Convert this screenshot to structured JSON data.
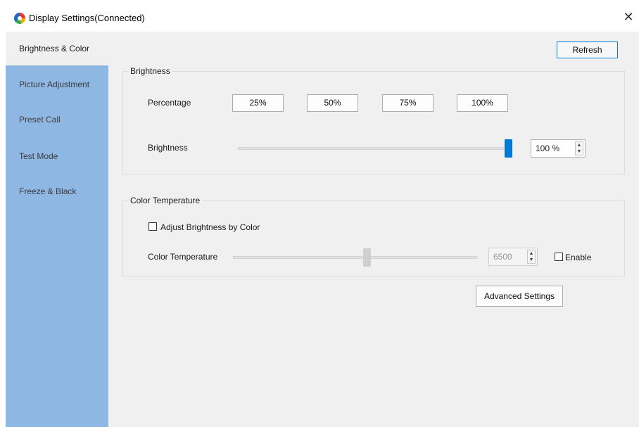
{
  "window": {
    "title": "Display Settings(Connected)",
    "close_icon": "close-icon",
    "close_glyph": "✕",
    "app_icon": "app-logo-icon"
  },
  "sidebar": {
    "items": [
      {
        "label": "Brightness & Color",
        "active": true
      },
      {
        "label": "Picture Adjustment",
        "active": false
      },
      {
        "label": "Preset Call",
        "active": false
      },
      {
        "label": "Test Mode",
        "active": false
      },
      {
        "label": "Freeze & Black",
        "active": false
      }
    ]
  },
  "toolbar": {
    "refresh_label": "Refresh"
  },
  "brightness_group": {
    "title": "Brightness",
    "percentage_label": "Percentage",
    "presets": [
      "25%",
      "50%",
      "75%",
      "100%"
    ],
    "slider_label": "Brightness",
    "slider_value": 100,
    "spin_value": "100 %"
  },
  "color_temp_group": {
    "title": "Color Temperature",
    "adjust_checkbox_label": "Adjust Brightness by Color",
    "adjust_checked": false,
    "slider_label": "Color Temperature",
    "slider_fraction": 0.55,
    "spin_value": "6500",
    "enable_label": "Enable",
    "enable_checked": false
  },
  "advanced_button_label": "Advanced Settings",
  "colors": {
    "sidebar": "#8fb7e4",
    "accent": "#0078d7",
    "panel": "#f0f0f0",
    "disabled_thumb": "#cfcfcf"
  }
}
